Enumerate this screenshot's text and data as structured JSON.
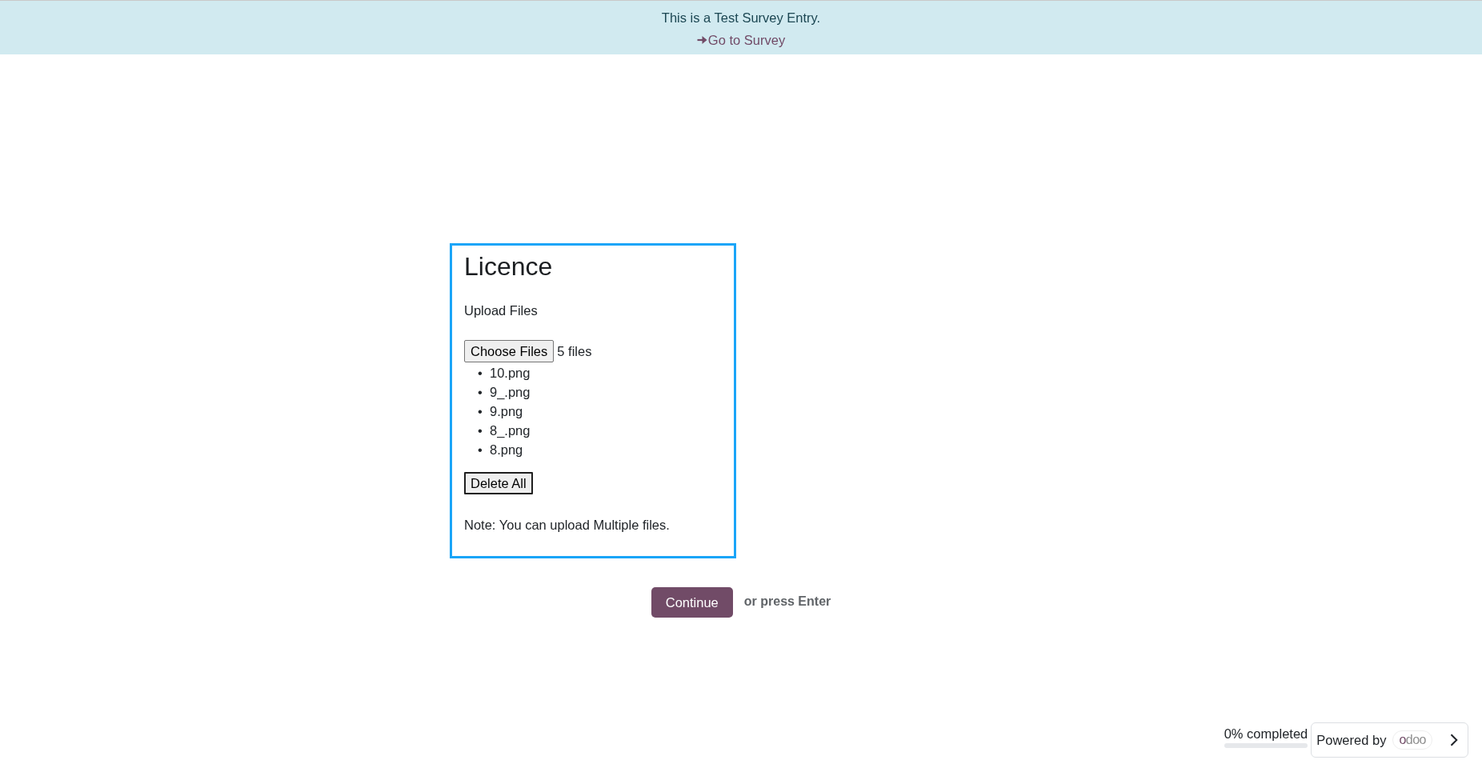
{
  "banner": {
    "message": "This is a Test Survey Entry.",
    "link": "Go to Survey"
  },
  "question": {
    "title": "Licence",
    "label": "Upload Files",
    "file_button": "Choose Files",
    "file_count": "5 files",
    "files": [
      {
        "bullet": "•",
        "name": "10.png"
      },
      {
        "bullet": "•",
        "name": "9_.png"
      },
      {
        "bullet": "•",
        "name": "9.png"
      },
      {
        "bullet": "•",
        "name": "8_.png"
      },
      {
        "bullet": "•",
        "name": "8.png"
      }
    ],
    "delete_button": "Delete All",
    "note": "Note: You can upload Multiple files."
  },
  "actions": {
    "continue_button": "Continue",
    "hint": "or press Enter"
  },
  "progress": {
    "label": "0% completed",
    "level": 0
  },
  "powered_by": {
    "label": "Powered by",
    "logo": "odoo"
  }
}
